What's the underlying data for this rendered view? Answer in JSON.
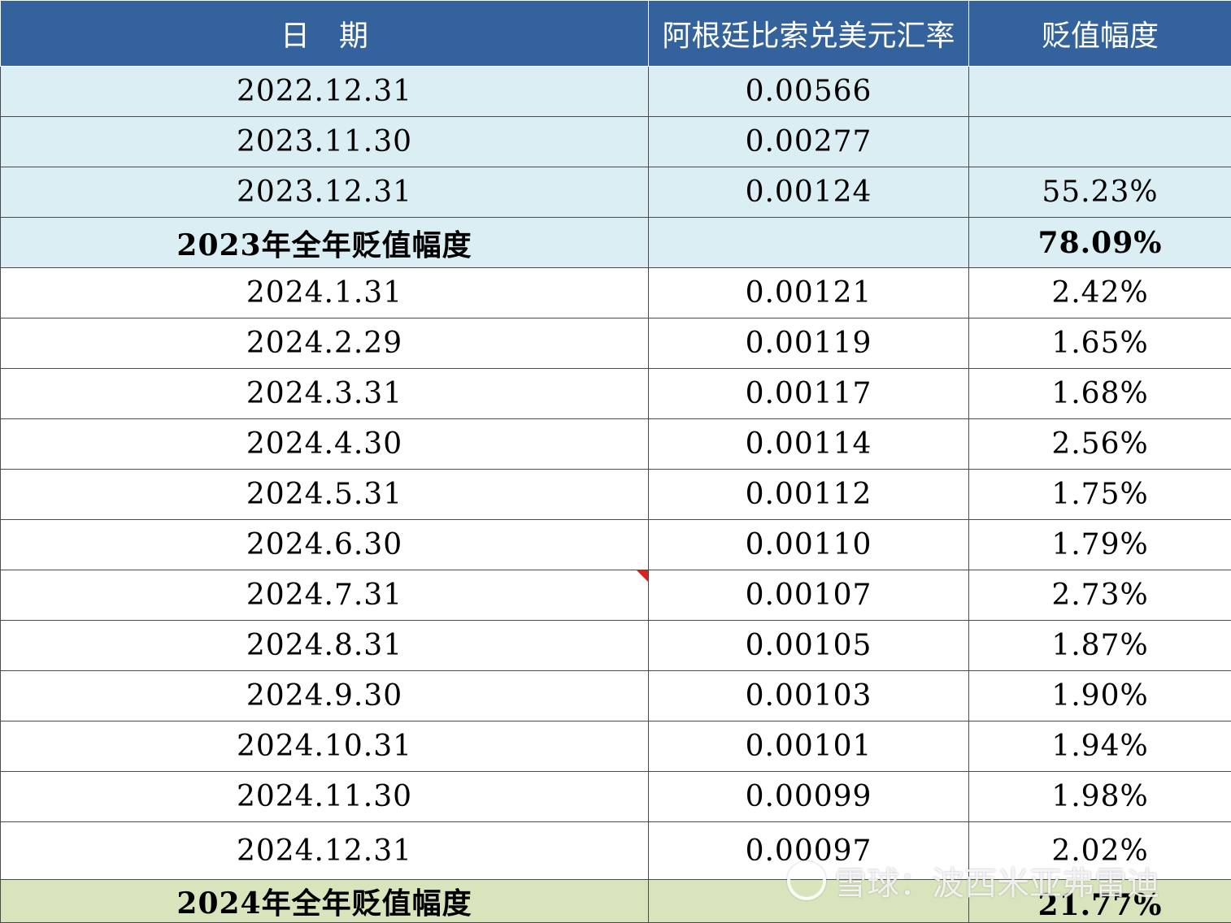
{
  "header": {
    "date": "日　期",
    "rate": "阿根廷比索兑美元汇率",
    "depreciation": "贬值幅度"
  },
  "rows_2023": [
    {
      "date": "2022.12.31",
      "rate": "0.00566",
      "dep": ""
    },
    {
      "date": "2023.11.30",
      "rate": "0.00277",
      "dep": ""
    },
    {
      "date": "2023.12.31",
      "rate": "0.00124",
      "dep": "55.23%"
    }
  ],
  "summary_2023": {
    "label": "2023年全年贬值幅度",
    "rate": "",
    "dep": "78.09%"
  },
  "rows_2024": [
    {
      "date": "2024.1.31",
      "rate": "0.00121",
      "dep": "2.42%"
    },
    {
      "date": "2024.2.29",
      "rate": "0.00119",
      "dep": "1.65%"
    },
    {
      "date": "2024.3.31",
      "rate": "0.00117",
      "dep": "1.68%"
    },
    {
      "date": "2024.4.30",
      "rate": "0.00114",
      "dep": "2.56%"
    },
    {
      "date": "2024.5.31",
      "rate": "0.00112",
      "dep": "1.75%"
    },
    {
      "date": "2024.6.30",
      "rate": "0.00110",
      "dep": "1.79%"
    },
    {
      "date": "2024.7.31",
      "rate": "0.00107",
      "dep": "2.73%"
    },
    {
      "date": "2024.8.31",
      "rate": "0.00105",
      "dep": "1.87%"
    },
    {
      "date": "2024.9.30",
      "rate": "0.00103",
      "dep": "1.90%"
    },
    {
      "date": "2024.10.31",
      "rate": "0.00101",
      "dep": "1.94%"
    },
    {
      "date": "2024.11.30",
      "rate": "0.00099",
      "dep": "1.98%"
    },
    {
      "date": "2024.12.31",
      "rate": "0.00097",
      "dep": "2.02%"
    }
  ],
  "summary_2024": {
    "label": "2024年全年贬值幅度",
    "rate": "",
    "dep": "21.77%"
  },
  "watermark": {
    "text": "雪球：波西米亚弗雷迪"
  },
  "colors": {
    "header_bg": "#34629c",
    "band_2023": "#daeef4",
    "summary_2024": "#d8e4bc",
    "comment_marker": "#e0201a"
  }
}
